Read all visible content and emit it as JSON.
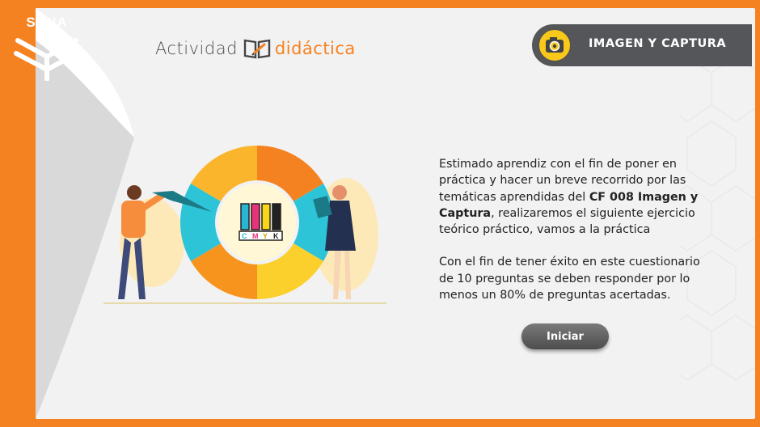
{
  "brand": {
    "logo_text": "SENA"
  },
  "header": {
    "title_part1": "Actividad",
    "title_part2": "didáctica",
    "book_icon": "open-book-pencil-icon"
  },
  "topic": {
    "label": "IMAGEN Y CAPTURA",
    "icon": "camera-icon"
  },
  "intro": {
    "p1_before": "Estimado aprendiz con el fin de poner en práctica y hacer un breve recorrido por las temáticas aprendidas del ",
    "p1_bold": "CF 008 Imagen y Captura",
    "p1_after": ", realizaremos el siguiente ejercicio teórico práctico, vamos a la práctica",
    "p2": "Con el fin de tener éxito en este cuestionario de 10 preguntas se deben responder por lo menos un 80% de preguntas acertadas."
  },
  "actions": {
    "start_label": "Iniciar"
  },
  "illustration": {
    "cmyk_labels": [
      "C",
      "M",
      "Y",
      "K"
    ]
  },
  "colors": {
    "accent": "#f58220",
    "badge_bg": "#555659",
    "badge_icon": "#f8c91a"
  }
}
